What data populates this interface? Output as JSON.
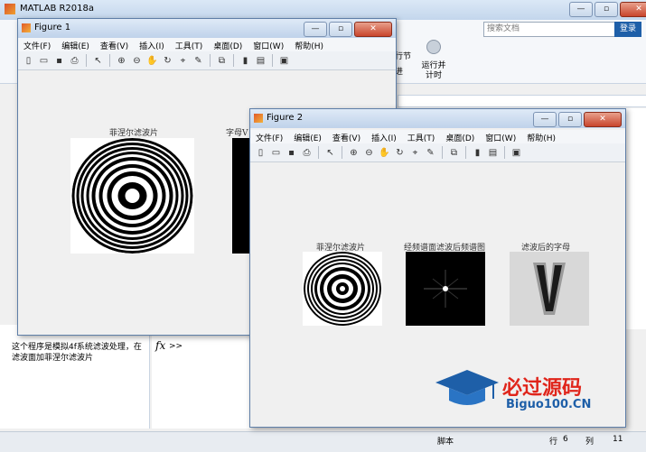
{
  "main": {
    "title": "MATLAB R2018a",
    "search_placeholder": "搜索文档",
    "login_label": "登录",
    "ribbon_snippet_a": "行节",
    "ribbon_snippet_b": "进",
    "run_advance_label": "运行并\n计时",
    "command_description": "这个程序是模拟4f系统滤波处理，在滤波面加菲涅尔滤波片",
    "fx_symbol": "fx",
    "prompt": ">>",
    "status": {
      "script": "脚本",
      "row_label": "行",
      "row": "6",
      "col_label": "列",
      "col": "11"
    }
  },
  "menu_items": [
    "文件(F)",
    "编辑(E)",
    "查看(V)",
    "插入(I)",
    "工具(T)",
    "桌面(D)",
    "窗口(W)",
    "帮助(H)"
  ],
  "figure1": {
    "title": "Figure 1",
    "plot1_label": "菲涅尔滤波片",
    "plot2_label": "字母V"
  },
  "figure2": {
    "title": "Figure 2",
    "plot1_label": "菲涅尔滤波片",
    "plot2_label": "经频谱面滤波后频谱图",
    "plot3_label": "滤波后的字母"
  },
  "watermark": {
    "line1": "必过源码",
    "line2": "Biguo100.CN"
  },
  "colors": {
    "titlebar": "#c3d6ec",
    "accent": "#1e5fa8",
    "watermark_red": "#e0251b"
  }
}
